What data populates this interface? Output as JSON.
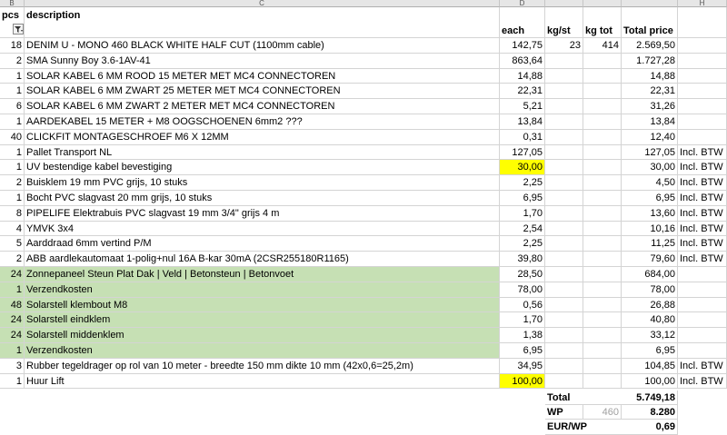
{
  "columns": [
    "B",
    "C",
    "",
    "D",
    "",
    "",
    "",
    "",
    "",
    "H"
  ],
  "headers": {
    "pcs": "pcs",
    "description": "description",
    "each": "each",
    "kgst": "kg/st",
    "kgtot": "kg tot",
    "total": "Total price"
  },
  "rows": [
    {
      "pcs": "18",
      "desc": "DENIM U - MONO 460 BLACK WHITE HALF CUT   (1100mm cable)",
      "each": "142,75",
      "kgst": "23",
      "kgtot": "414",
      "total": "2.569,50",
      "note": "",
      "hl": ""
    },
    {
      "pcs": "2",
      "desc": "SMA Sunny Boy 3.6-1AV-41",
      "each": "863,64",
      "kgst": "",
      "kgtot": "",
      "total": "1.727,28",
      "note": "",
      "hl": ""
    },
    {
      "pcs": "1",
      "desc": "SOLAR KABEL 6 MM ROOD 15 METER MET MC4 CONNECTOREN",
      "each": "14,88",
      "kgst": "",
      "kgtot": "",
      "total": "14,88",
      "note": "",
      "hl": ""
    },
    {
      "pcs": "1",
      "desc": "SOLAR KABEL 6 MM ZWART 25 METER MET MC4 CONNECTOREN",
      "each": "22,31",
      "kgst": "",
      "kgtot": "",
      "total": "22,31",
      "note": "",
      "hl": ""
    },
    {
      "pcs": "6",
      "desc": "SOLAR KABEL 6 MM ZWART 2 METER MET MC4 CONNECTOREN",
      "each": "5,21",
      "kgst": "",
      "kgtot": "",
      "total": "31,26",
      "note": "",
      "hl": ""
    },
    {
      "pcs": "1",
      "desc": "AARDEKABEL 15 METER + M8 OOGSCHOENEN     6mm2 ???",
      "each": "13,84",
      "kgst": "",
      "kgtot": "",
      "total": "13,84",
      "note": "",
      "hl": ""
    },
    {
      "pcs": "40",
      "desc": "CLICKFIT MONTAGESCHROEF M6 X 12MM",
      "each": "0,31",
      "kgst": "",
      "kgtot": "",
      "total": "12,40",
      "note": "",
      "hl": ""
    },
    {
      "pcs": "1",
      "desc": "Pallet Transport NL",
      "each": "127,05",
      "kgst": "",
      "kgtot": "",
      "total": "127,05",
      "note": "Incl. BTW",
      "hl": ""
    },
    {
      "pcs": "1",
      "desc": "UV bestendige kabel bevestiging",
      "each": "30,00",
      "kgst": "",
      "kgtot": "",
      "total": "30,00",
      "note": "Incl. BTW",
      "hl": "yellow"
    },
    {
      "pcs": "2",
      "desc": "Buisklem 19 mm PVC grijs, 10 stuks",
      "each": "2,25",
      "kgst": "",
      "kgtot": "",
      "total": "4,50",
      "note": "Incl. BTW",
      "hl": ""
    },
    {
      "pcs": "1",
      "desc": "Bocht PVC slagvast 20 mm grijs, 10 stuks",
      "each": "6,95",
      "kgst": "",
      "kgtot": "",
      "total": "6,95",
      "note": "Incl. BTW",
      "hl": ""
    },
    {
      "pcs": "8",
      "desc": "PIPELIFE Elektrabuis PVC slagvast 19 mm 3/4\" grijs 4 m",
      "each": "1,70",
      "kgst": "",
      "kgtot": "",
      "total": "13,60",
      "note": "Incl. BTW",
      "hl": ""
    },
    {
      "pcs": "4",
      "desc": "YMVK 3x4",
      "each": "2,54",
      "kgst": "",
      "kgtot": "",
      "total": "10,16",
      "note": "Incl. BTW",
      "hl": ""
    },
    {
      "pcs": "5",
      "desc": "Aarddraad 6mm vertind P/M",
      "each": "2,25",
      "kgst": "",
      "kgtot": "",
      "total": "11,25",
      "note": "Incl. BTW",
      "hl": ""
    },
    {
      "pcs": "2",
      "desc": "ABB aardlekautomaat 1-polig+nul 16A B-kar 30mA (2CSR255180R1165)",
      "each": "39,80",
      "kgst": "",
      "kgtot": "",
      "total": "79,60",
      "note": "Incl. BTW",
      "hl": ""
    },
    {
      "pcs": "24",
      "desc": "Zonnepaneel Steun Plat Dak | Veld | Betonsteun | Betonvoet",
      "each": "28,50",
      "kgst": "",
      "kgtot": "",
      "total": "684,00",
      "note": "",
      "hl": "green"
    },
    {
      "pcs": "1",
      "desc": "Verzendkosten",
      "each": "78,00",
      "kgst": "",
      "kgtot": "",
      "total": "78,00",
      "note": "",
      "hl": "green"
    },
    {
      "pcs": "48",
      "desc": "Solarstell klembout M8",
      "each": "0,56",
      "kgst": "",
      "kgtot": "",
      "total": "26,88",
      "note": "",
      "hl": "green"
    },
    {
      "pcs": "24",
      "desc": "Solarstell eindklem",
      "each": "1,70",
      "kgst": "",
      "kgtot": "",
      "total": "40,80",
      "note": "",
      "hl": "green"
    },
    {
      "pcs": "24",
      "desc": "Solarstell middenklem",
      "each": "1,38",
      "kgst": "",
      "kgtot": "",
      "total": "33,12",
      "note": "",
      "hl": "green"
    },
    {
      "pcs": "1",
      "desc": "Verzendkosten",
      "each": "6,95",
      "kgst": "",
      "kgtot": "",
      "total": "6,95",
      "note": "",
      "hl": "green"
    },
    {
      "pcs": "3",
      "desc": "Rubber tegeldrager op rol van 10 meter - breedte 150 mm dikte 10 mm (42x0,6=25,2m)",
      "each": "34,95",
      "kgst": "",
      "kgtot": "",
      "total": "104,85",
      "note": "Incl. BTW",
      "hl": ""
    },
    {
      "pcs": "1",
      "desc": "Huur Lift",
      "each": "100,00",
      "kgst": "",
      "kgtot": "",
      "total": "100,00",
      "note": "Incl. BTW",
      "hl": "yellow"
    }
  ],
  "summary": {
    "total_label": "Total",
    "total_value": "5.749,18",
    "wp_label": "WP",
    "wp_gray": "460",
    "wp_value": "8.280",
    "eurwp_label": "EUR/WP",
    "eurwp_value": "0,69"
  },
  "colors": {
    "green": "#c6e0b4",
    "yellow": "#ffff00"
  }
}
